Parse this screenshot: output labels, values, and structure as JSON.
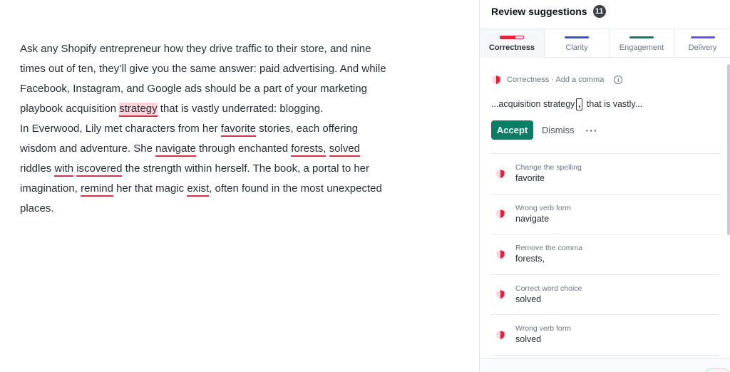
{
  "editor": {
    "paragraph1": {
      "before": "Ask any Shopify entrepreneur how they drive traffic to their store, and nine times out of ten, they’ll give you the same answer: paid advertising. And while Facebook, Instagram, and Google ads should be a part of your marketing playbook acquisition ",
      "flag": "strategy",
      "after": " that is vastly underrated: blogging."
    },
    "paragraph2": {
      "t1": "In Everwood, Lily met characters from her ",
      "f1": "favorite",
      "t2": " stories, each offering wisdom and adventure. She ",
      "f2": "navigate",
      "t3": " through enchanted ",
      "f3": "forests,",
      "t4": " ",
      "f4": "solved",
      "t5": " riddles ",
      "f5": "with",
      "t6": " ",
      "f6": "iscovered",
      "t7": " the strength within herself. The book, a portal to her imagination, ",
      "f7": "remind",
      "t8": " her that magic ",
      "f8": "exist",
      "t9": ", often found in the most unexpected places."
    }
  },
  "sidebar": {
    "title": "Review suggestions",
    "count": "11",
    "tabs": [
      {
        "label": "Correctness",
        "color": "#e0223b",
        "active": true
      },
      {
        "label": "Clarity",
        "color": "#2f55d4"
      },
      {
        "label": "Engagement",
        "color": "#0a7e64"
      },
      {
        "label": "Delivery",
        "color": "#6b4ff0"
      }
    ],
    "main_card": {
      "category": "Correctness · Add a comma",
      "info_icon": "i",
      "text_before": "...acquisition strategy",
      "comma": ",",
      "text_after": " that is vastly...",
      "accept": "Accept",
      "dismiss": "Dismiss",
      "more": "···"
    },
    "suggestions": [
      {
        "category": "Change the spelling",
        "word": "favorite"
      },
      {
        "category": "Wrong verb form",
        "word": "navigate"
      },
      {
        "category": "Remove the comma",
        "word": "forests,"
      },
      {
        "category": "Correct word choice",
        "word": "solved"
      },
      {
        "category": "Wrong verb form",
        "word": "solved"
      }
    ]
  },
  "icons": {
    "correctness": "shield-icon",
    "info": "info-icon",
    "more": "more-options-icon"
  }
}
